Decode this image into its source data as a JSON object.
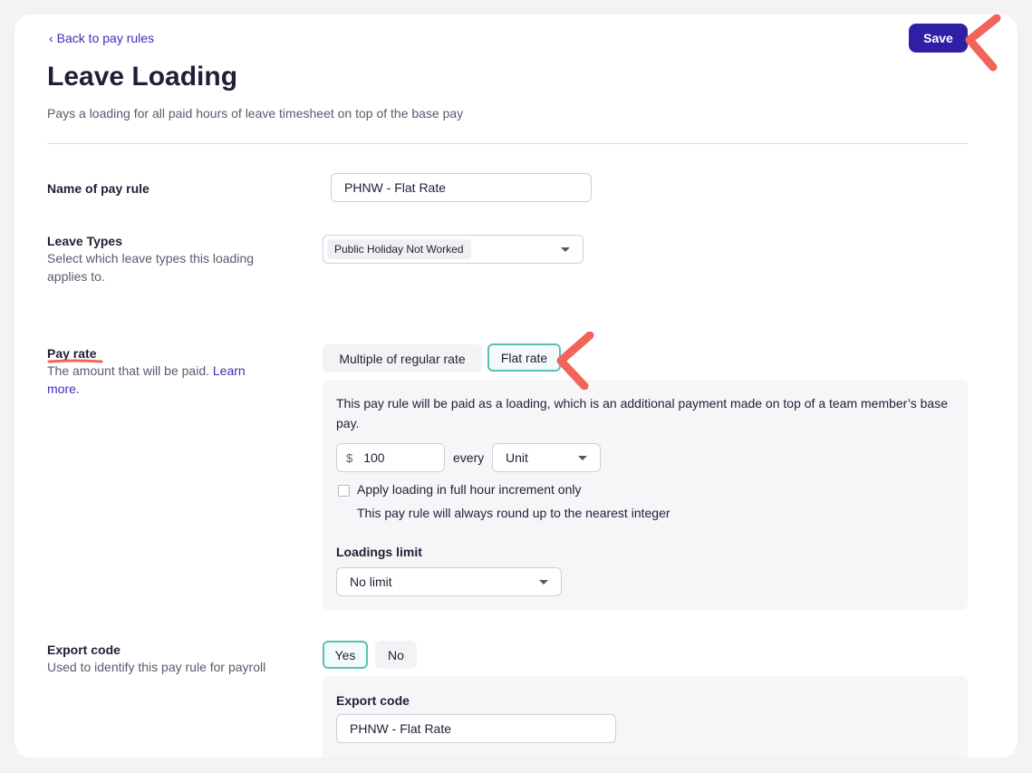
{
  "header": {
    "back_label": "Back to pay rules",
    "save_label": "Save",
    "title": "Leave Loading",
    "subtitle": "Pays a loading for all paid hours of leave timesheet on top of the base pay"
  },
  "name_section": {
    "label": "Name of pay rule",
    "value": "PHNW - Flat Rate"
  },
  "leave_types": {
    "label": "Leave Types",
    "help": "Select which leave types this loading applies to.",
    "selected_chip": "Public Holiday Not Worked"
  },
  "pay_rate": {
    "label": "Pay rate",
    "help_text": "The amount that will be paid.",
    "learn_more": "Learn more.",
    "options": [
      "Multiple of regular rate",
      "Flat rate"
    ],
    "selected_option": "Flat rate",
    "panel_description": "This pay rule will be paid as a loading, which is an additional payment made on top of a team member’s base pay.",
    "currency_symbol": "$",
    "amount": "100",
    "every_label": "every",
    "unit": "Unit",
    "checkbox_label": "Apply loading in full hour increment only",
    "checkbox_checked": false,
    "checkbox_help": "This pay rule will always round up to the nearest integer",
    "loadings_limit_label": "Loadings limit",
    "loadings_limit_value": "No limit"
  },
  "export_code": {
    "label": "Export code",
    "help": "Used to identify this pay rule for payroll",
    "options": [
      "Yes",
      "No"
    ],
    "selected_option": "Yes",
    "field_label": "Export code",
    "field_value": "PHNW - Flat Rate"
  },
  "colors": {
    "primary": "#2f1fa7",
    "link": "#3b2fb5",
    "active_border": "#5bbfb5",
    "annotation": "#f2645a"
  }
}
